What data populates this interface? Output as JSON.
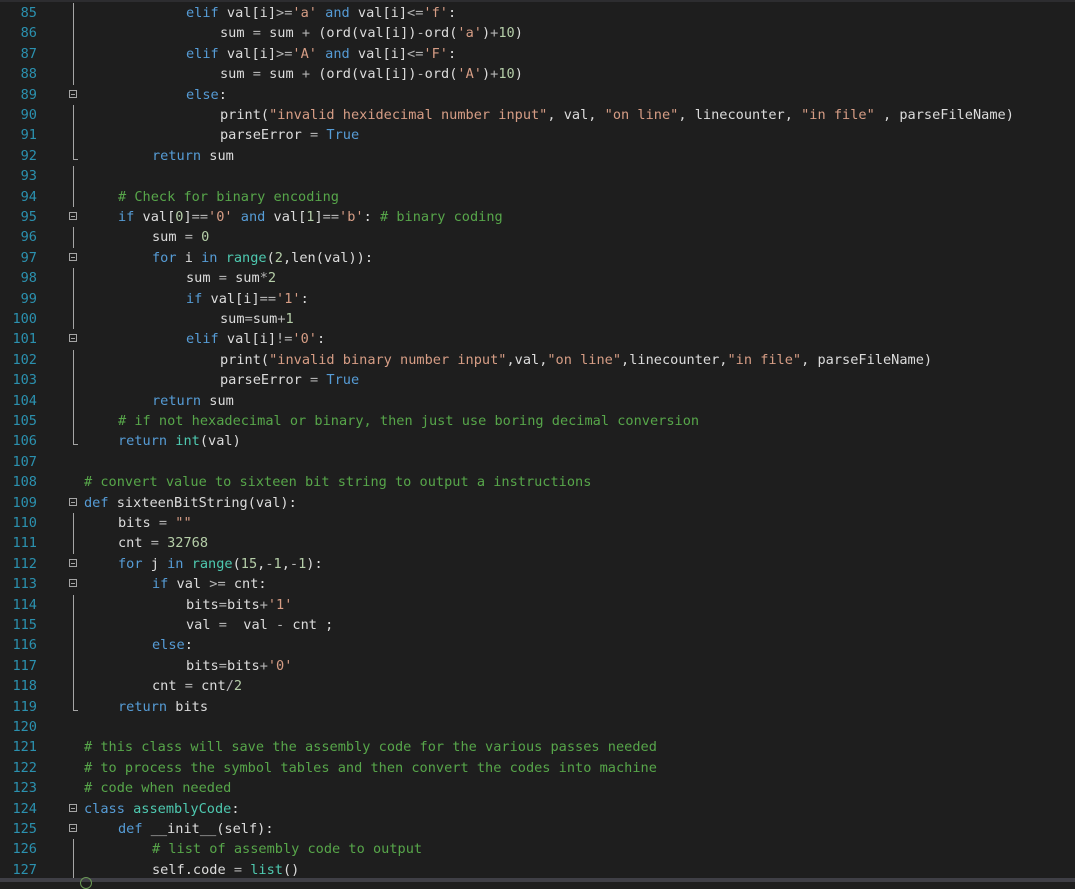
{
  "editor": {
    "colors": {
      "background": "#1e1e1e",
      "line_number": "#2b91af",
      "keyword": "#569cd6",
      "string": "#d69d85",
      "comment": "#57a64a",
      "number": "#b5cea8",
      "builtin": "#4ec9b0",
      "identifier": "#dcdcdc",
      "fold_marker": "#a5a5a5"
    },
    "lines": [
      {
        "n": "85",
        "indent": 12,
        "fold": "line",
        "tokens": [
          [
            "kw",
            "elif"
          ],
          [
            "id",
            " val[i]"
          ],
          [
            "op",
            ">="
          ],
          [
            "str",
            "'a'"
          ],
          [
            "id",
            " "
          ],
          [
            "kw",
            "and"
          ],
          [
            "id",
            " val[i]"
          ],
          [
            "op",
            "<="
          ],
          [
            "str",
            "'f'"
          ],
          [
            "id",
            ":"
          ]
        ]
      },
      {
        "n": "86",
        "indent": 16,
        "fold": "line",
        "tokens": [
          [
            "id",
            "sum "
          ],
          [
            "op",
            "="
          ],
          [
            "id",
            " sum "
          ],
          [
            "op",
            "+"
          ],
          [
            "id",
            " (ord(val[i])"
          ],
          [
            "op",
            "-"
          ],
          [
            "id",
            "ord("
          ],
          [
            "str",
            "'a'"
          ],
          [
            "id",
            ")"
          ],
          [
            "op",
            "+"
          ],
          [
            "num",
            "10"
          ],
          [
            "id",
            ")"
          ]
        ]
      },
      {
        "n": "87",
        "indent": 12,
        "fold": "line",
        "tokens": [
          [
            "kw",
            "elif"
          ],
          [
            "id",
            " val[i]"
          ],
          [
            "op",
            ">="
          ],
          [
            "str",
            "'A'"
          ],
          [
            "id",
            " "
          ],
          [
            "kw",
            "and"
          ],
          [
            "id",
            " val[i]"
          ],
          [
            "op",
            "<="
          ],
          [
            "str",
            "'F'"
          ],
          [
            "id",
            ":"
          ]
        ]
      },
      {
        "n": "88",
        "indent": 16,
        "fold": "line",
        "tokens": [
          [
            "id",
            "sum "
          ],
          [
            "op",
            "="
          ],
          [
            "id",
            " sum "
          ],
          [
            "op",
            "+"
          ],
          [
            "id",
            " (ord(val[i])"
          ],
          [
            "op",
            "-"
          ],
          [
            "id",
            "ord("
          ],
          [
            "str",
            "'A'"
          ],
          [
            "id",
            ")"
          ],
          [
            "op",
            "+"
          ],
          [
            "num",
            "10"
          ],
          [
            "id",
            ")"
          ]
        ]
      },
      {
        "n": "89",
        "indent": 12,
        "fold": "box",
        "tokens": [
          [
            "kw",
            "else"
          ],
          [
            "id",
            ":"
          ]
        ]
      },
      {
        "n": "90",
        "indent": 16,
        "fold": "line",
        "tokens": [
          [
            "id",
            "print("
          ],
          [
            "str",
            "\"invalid hexidecimal number input\""
          ],
          [
            "id",
            ", val, "
          ],
          [
            "str",
            "\"on line\""
          ],
          [
            "id",
            ", linecounter, "
          ],
          [
            "str",
            "\"in file\""
          ],
          [
            "id",
            " , parseFileName)"
          ]
        ]
      },
      {
        "n": "91",
        "indent": 16,
        "fold": "line",
        "tokens": [
          [
            "id",
            "parseError "
          ],
          [
            "op",
            "="
          ],
          [
            "id",
            " "
          ],
          [
            "kw",
            "True"
          ]
        ]
      },
      {
        "n": "92",
        "indent": 8,
        "fold": "end",
        "tokens": [
          [
            "kw",
            "return"
          ],
          [
            "id",
            " sum"
          ]
        ]
      },
      {
        "n": "93",
        "indent": 0,
        "fold": "line",
        "tokens": []
      },
      {
        "n": "94",
        "indent": 4,
        "fold": "line",
        "tokens": [
          [
            "cm",
            "# Check for binary encoding"
          ]
        ]
      },
      {
        "n": "95",
        "indent": 4,
        "fold": "box",
        "tokens": [
          [
            "kw",
            "if"
          ],
          [
            "id",
            " val["
          ],
          [
            "num",
            "0"
          ],
          [
            "id",
            "]"
          ],
          [
            "op",
            "=="
          ],
          [
            "str",
            "'0'"
          ],
          [
            "id",
            " "
          ],
          [
            "kw",
            "and"
          ],
          [
            "id",
            " val["
          ],
          [
            "num",
            "1"
          ],
          [
            "id",
            "]"
          ],
          [
            "op",
            "=="
          ],
          [
            "str",
            "'b'"
          ],
          [
            "id",
            ": "
          ],
          [
            "cm",
            "# binary coding"
          ]
        ]
      },
      {
        "n": "96",
        "indent": 8,
        "fold": "line",
        "tokens": [
          [
            "id",
            "sum "
          ],
          [
            "op",
            "="
          ],
          [
            "id",
            " "
          ],
          [
            "num",
            "0"
          ]
        ]
      },
      {
        "n": "97",
        "indent": 8,
        "fold": "box",
        "tokens": [
          [
            "kw",
            "for"
          ],
          [
            "id",
            " i "
          ],
          [
            "kw",
            "in"
          ],
          [
            "id",
            " "
          ],
          [
            "bi",
            "range"
          ],
          [
            "id",
            "("
          ],
          [
            "num",
            "2"
          ],
          [
            "id",
            ",len(val)):"
          ]
        ]
      },
      {
        "n": "98",
        "indent": 12,
        "fold": "line",
        "tokens": [
          [
            "id",
            "sum "
          ],
          [
            "op",
            "="
          ],
          [
            "id",
            " sum"
          ],
          [
            "op",
            "*"
          ],
          [
            "num",
            "2"
          ]
        ]
      },
      {
        "n": "99",
        "indent": 12,
        "fold": "line",
        "tokens": [
          [
            "kw",
            "if"
          ],
          [
            "id",
            " val[i]"
          ],
          [
            "op",
            "=="
          ],
          [
            "str",
            "'1'"
          ],
          [
            "id",
            ":"
          ]
        ]
      },
      {
        "n": "100",
        "indent": 16,
        "fold": "line",
        "tokens": [
          [
            "id",
            "sum"
          ],
          [
            "op",
            "="
          ],
          [
            "id",
            "sum"
          ],
          [
            "op",
            "+"
          ],
          [
            "num",
            "1"
          ]
        ]
      },
      {
        "n": "101",
        "indent": 12,
        "fold": "box",
        "tokens": [
          [
            "kw",
            "elif"
          ],
          [
            "id",
            " val[i]"
          ],
          [
            "op",
            "!="
          ],
          [
            "str",
            "'0'"
          ],
          [
            "id",
            ":"
          ]
        ]
      },
      {
        "n": "102",
        "indent": 16,
        "fold": "line",
        "tokens": [
          [
            "id",
            "print("
          ],
          [
            "str",
            "\"invalid binary number input\""
          ],
          [
            "id",
            ",val,"
          ],
          [
            "str",
            "\"on line\""
          ],
          [
            "id",
            ",linecounter,"
          ],
          [
            "str",
            "\"in file\""
          ],
          [
            "id",
            ", parseFileName)"
          ]
        ]
      },
      {
        "n": "103",
        "indent": 16,
        "fold": "line",
        "tokens": [
          [
            "id",
            "parseError "
          ],
          [
            "op",
            "="
          ],
          [
            "id",
            " "
          ],
          [
            "kw",
            "True"
          ]
        ]
      },
      {
        "n": "104",
        "indent": 8,
        "fold": "line",
        "tokens": [
          [
            "kw",
            "return"
          ],
          [
            "id",
            " sum"
          ]
        ]
      },
      {
        "n": "105",
        "indent": 4,
        "fold": "line",
        "tokens": [
          [
            "cm",
            "# if not hexadecimal or binary, then just use boring decimal conversion"
          ]
        ]
      },
      {
        "n": "106",
        "indent": 4,
        "fold": "end",
        "tokens": [
          [
            "kw",
            "return"
          ],
          [
            "id",
            " "
          ],
          [
            "bi",
            "int"
          ],
          [
            "id",
            "(val)"
          ]
        ]
      },
      {
        "n": "107",
        "indent": 0,
        "fold": "none",
        "tokens": []
      },
      {
        "n": "108",
        "indent": 0,
        "fold": "none",
        "tokens": [
          [
            "cm",
            "# convert value to sixteen bit string to output a instructions"
          ]
        ]
      },
      {
        "n": "109",
        "indent": 0,
        "fold": "box",
        "tokens": [
          [
            "kw",
            "def"
          ],
          [
            "id",
            " sixteenBitString(val):"
          ]
        ]
      },
      {
        "n": "110",
        "indent": 4,
        "fold": "line",
        "tokens": [
          [
            "id",
            "bits "
          ],
          [
            "op",
            "="
          ],
          [
            "id",
            " "
          ],
          [
            "str",
            "\"\""
          ]
        ]
      },
      {
        "n": "111",
        "indent": 4,
        "fold": "line",
        "tokens": [
          [
            "id",
            "cnt "
          ],
          [
            "op",
            "="
          ],
          [
            "id",
            " "
          ],
          [
            "num",
            "32768"
          ]
        ]
      },
      {
        "n": "112",
        "indent": 4,
        "fold": "box",
        "tokens": [
          [
            "kw",
            "for"
          ],
          [
            "id",
            " j "
          ],
          [
            "kw",
            "in"
          ],
          [
            "id",
            " "
          ],
          [
            "bi",
            "range"
          ],
          [
            "id",
            "("
          ],
          [
            "num",
            "15"
          ],
          [
            "id",
            ","
          ],
          [
            "op",
            "-"
          ],
          [
            "num",
            "1"
          ],
          [
            "id",
            ","
          ],
          [
            "op",
            "-"
          ],
          [
            "num",
            "1"
          ],
          [
            "id",
            "):"
          ]
        ]
      },
      {
        "n": "113",
        "indent": 8,
        "fold": "box",
        "tokens": [
          [
            "kw",
            "if"
          ],
          [
            "id",
            " val "
          ],
          [
            "op",
            ">="
          ],
          [
            "id",
            " cnt:"
          ]
        ]
      },
      {
        "n": "114",
        "indent": 12,
        "fold": "line",
        "tokens": [
          [
            "id",
            "bits"
          ],
          [
            "op",
            "="
          ],
          [
            "id",
            "bits"
          ],
          [
            "op",
            "+"
          ],
          [
            "str",
            "'1'"
          ]
        ]
      },
      {
        "n": "115",
        "indent": 12,
        "fold": "line",
        "tokens": [
          [
            "id",
            "val "
          ],
          [
            "op",
            "="
          ],
          [
            "id",
            "  val "
          ],
          [
            "op",
            "-"
          ],
          [
            "id",
            " cnt ;"
          ]
        ]
      },
      {
        "n": "116",
        "indent": 8,
        "fold": "line",
        "tokens": [
          [
            "kw",
            "else"
          ],
          [
            "id",
            ":"
          ]
        ]
      },
      {
        "n": "117",
        "indent": 12,
        "fold": "line",
        "tokens": [
          [
            "id",
            "bits"
          ],
          [
            "op",
            "="
          ],
          [
            "id",
            "bits"
          ],
          [
            "op",
            "+"
          ],
          [
            "str",
            "'0'"
          ]
        ]
      },
      {
        "n": "118",
        "indent": 8,
        "fold": "line",
        "tokens": [
          [
            "id",
            "cnt "
          ],
          [
            "op",
            "="
          ],
          [
            "id",
            " cnt"
          ],
          [
            "op",
            "/"
          ],
          [
            "num",
            "2"
          ]
        ]
      },
      {
        "n": "119",
        "indent": 4,
        "fold": "end",
        "tokens": [
          [
            "kw",
            "return"
          ],
          [
            "id",
            " bits"
          ]
        ]
      },
      {
        "n": "120",
        "indent": 0,
        "fold": "none",
        "tokens": []
      },
      {
        "n": "121",
        "indent": 0,
        "fold": "none",
        "tokens": [
          [
            "cm",
            "# this class will save the assembly code for the various passes needed"
          ]
        ]
      },
      {
        "n": "122",
        "indent": 0,
        "fold": "none",
        "tokens": [
          [
            "cm",
            "# to process the symbol tables and then convert the codes into machine"
          ]
        ]
      },
      {
        "n": "123",
        "indent": 0,
        "fold": "none",
        "tokens": [
          [
            "cm",
            "# code when needed"
          ]
        ]
      },
      {
        "n": "124",
        "indent": 0,
        "fold": "box",
        "tokens": [
          [
            "kw",
            "class"
          ],
          [
            "id",
            " "
          ],
          [
            "bi",
            "assemblyCode"
          ],
          [
            "id",
            ":"
          ]
        ]
      },
      {
        "n": "125",
        "indent": 4,
        "fold": "box",
        "tokens": [
          [
            "kw",
            "def"
          ],
          [
            "id",
            " __init__(self):"
          ]
        ]
      },
      {
        "n": "126",
        "indent": 8,
        "fold": "line",
        "tokens": [
          [
            "cm",
            "# list of assembly code to output"
          ]
        ]
      },
      {
        "n": "127",
        "indent": 8,
        "fold": "line",
        "tokens": [
          [
            "id",
            "self.code "
          ],
          [
            "op",
            "="
          ],
          [
            "id",
            " "
          ],
          [
            "bi",
            "list"
          ],
          [
            "id",
            "()"
          ]
        ]
      }
    ]
  }
}
